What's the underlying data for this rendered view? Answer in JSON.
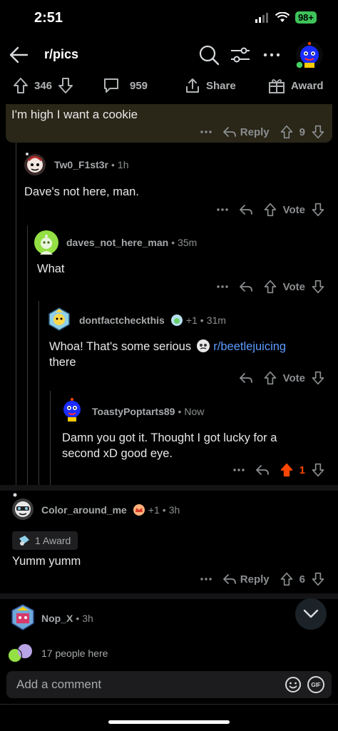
{
  "status_bar": {
    "time": "2:51",
    "battery": "98+"
  },
  "header": {
    "title": "r/pics"
  },
  "post_actions": {
    "upvotes": "346",
    "comments": "959",
    "share_label": "Share",
    "award_label": "Award"
  },
  "highlighted_comment": {
    "text": "I'm high I want a cookie",
    "reply_label": "Reply",
    "score": "9"
  },
  "comments": [
    {
      "user": "Tw0_F1st3r",
      "time": "1h",
      "body": "Dave's not here, man.",
      "vote_label": "Vote"
    },
    {
      "user": "daves_not_here_man",
      "time": "35m",
      "body": "What",
      "vote_label": "Vote"
    },
    {
      "user": "dontfactcheckthis",
      "flair_karma": "+1",
      "time": "31m",
      "body_before": "Whoa! That's some serious",
      "subreddit_link": "r/beetlejuicing",
      "body_after": "there",
      "vote_label": "Vote"
    },
    {
      "user": "ToastyPoptarts89",
      "time": "Now",
      "body": "Damn you got it. Thought I got lucky for a second xD good eye.",
      "score": "1"
    },
    {
      "user": "Color_around_me",
      "flair_karma": "+1",
      "time": "3h",
      "award": "1 Award",
      "body": "Yumm yumm",
      "reply_label": "Reply",
      "score": "6"
    },
    {
      "user": "Nop_X",
      "time": "3h"
    }
  ],
  "footer": {
    "people_here": "17 people here",
    "composer_placeholder": "Add a comment",
    "gif_label": "GIF"
  },
  "colors": {
    "accent_upvote": "#ff4500",
    "link": "#5b9bff",
    "highlight_bg": "#2a2618",
    "battery": "#3ec35a"
  }
}
